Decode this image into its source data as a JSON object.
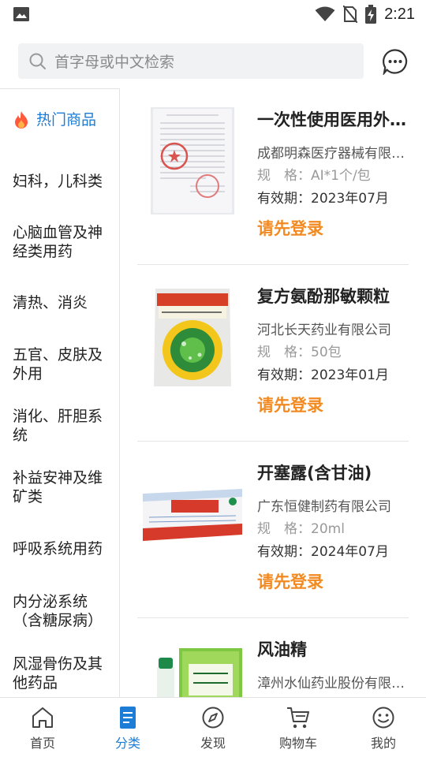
{
  "status_bar": {
    "time": "2:21"
  },
  "search": {
    "placeholder": "首字母或中文检索"
  },
  "sidebar": {
    "items": [
      {
        "label": "热门商品",
        "active": true
      },
      {
        "label": "妇科，儿科类"
      },
      {
        "label": "心脑血管及神经类用药"
      },
      {
        "label": "清热、消炎"
      },
      {
        "label": "五官、皮肤及外用"
      },
      {
        "label": "消化、肝胆系统"
      },
      {
        "label": "补益安神及维矿类"
      },
      {
        "label": "呼吸系统用药"
      },
      {
        "label": "内分泌系统（含糖尿病）"
      },
      {
        "label": "风湿骨伤及其他药品"
      }
    ]
  },
  "products": [
    {
      "title": "一次性使用医用外科口罩",
      "maker": "成都明森医疗器械有限公司",
      "spec": "规　格：AI*1个/包",
      "expiry": "有效期：2023年07月",
      "action": "请先登录"
    },
    {
      "title": "复方氨酚那敏颗粒",
      "maker": "河北长天药业有限公司",
      "spec": "规　格：50包",
      "expiry": "有效期：2023年01月",
      "action": "请先登录"
    },
    {
      "title": "开塞露(含甘油)",
      "maker": "广东恒健制药有限公司",
      "spec": "规　格：20ml",
      "expiry": "有效期：2024年07月",
      "action": "请先登录"
    },
    {
      "title": "风油精",
      "maker": "漳州水仙药业股份有限公司",
      "spec": "",
      "expiry": "",
      "action": ""
    }
  ],
  "tabs": [
    {
      "label": "首页",
      "icon": "home-icon"
    },
    {
      "label": "分类",
      "icon": "category-icon",
      "active": true
    },
    {
      "label": "发现",
      "icon": "compass-icon"
    },
    {
      "label": "购物车",
      "icon": "cart-icon"
    },
    {
      "label": "我的",
      "icon": "smiley-icon"
    }
  ],
  "colors": {
    "accent": "#1c7cd6",
    "login": "#f28a22"
  }
}
